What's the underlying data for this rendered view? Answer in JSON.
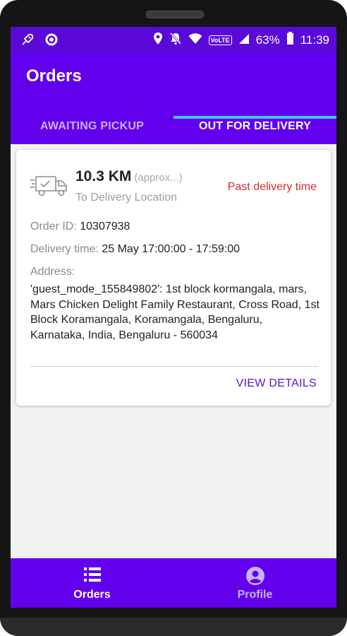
{
  "status_bar": {
    "battery": "63%",
    "time": "11:39",
    "volte": "VoLTE"
  },
  "app": {
    "title": "Orders"
  },
  "tabs": [
    {
      "label": "AWAITING PICKUP",
      "active": false
    },
    {
      "label": "OUT FOR DELIVERY",
      "active": true
    }
  ],
  "order": {
    "distance": "10.3 KM",
    "approx": "(approx...)",
    "distance_sub": "To Delivery Location",
    "status": "Past delivery time",
    "order_id_label": "Order ID:",
    "order_id": "10307938",
    "delivery_time_label": "Delivery time:",
    "delivery_time": "25 May 17:00:00 - 17:59:00",
    "address_label": "Address:",
    "address": "'guest_mode_155849802': 1st block kormangala, mars, Mars Chicken Delight Family Restaurant, Cross Road, 1st Block Koramangala, Koramangala, Bengaluru, Karnataka, India, Bengaluru - 560034",
    "view_details": "VIEW DETAILS"
  },
  "bottom_nav": {
    "items": [
      {
        "label": "Orders",
        "icon": "list-icon",
        "active": true
      },
      {
        "label": "Profile",
        "icon": "account-circle-icon",
        "active": false
      }
    ]
  },
  "colors": {
    "primary": "#6200ee",
    "status_bar": "#5b09d9",
    "tab_indicator": "#41c8e6",
    "warning": "#d32f2f",
    "link": "#5a12d6"
  }
}
